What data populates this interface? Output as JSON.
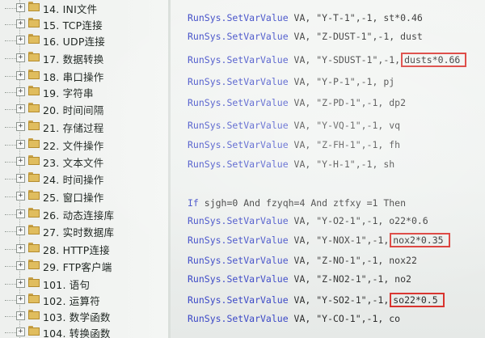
{
  "tree": {
    "items": [
      {
        "label": "14. INI文件"
      },
      {
        "label": "15. TCP连接"
      },
      {
        "label": "16. UDP连接"
      },
      {
        "label": "17. 数据转换"
      },
      {
        "label": "18. 串口操作"
      },
      {
        "label": "19. 字符串"
      },
      {
        "label": "20. 时间间隔"
      },
      {
        "label": "21. 存储过程"
      },
      {
        "label": "22. 文件操作"
      },
      {
        "label": "23. 文本文件"
      },
      {
        "label": "24. 时间操作"
      },
      {
        "label": "25. 窗口操作"
      },
      {
        "label": "26. 动态连接库"
      },
      {
        "label": "27. 实时数据库"
      },
      {
        "label": "28. HTTP连接"
      },
      {
        "label": "29. FTP客户端"
      },
      {
        "label": "101. 语句"
      },
      {
        "label": "102. 运算符"
      },
      {
        "label": "103. 数学函数"
      },
      {
        "label": "104. 转换函数"
      }
    ],
    "expander_symbol": "+"
  },
  "code": {
    "lines": [
      {
        "kw": "RunSys.SetVarValue",
        "rest": " VA, \"Y-T-1\",-1, st*0.46",
        "hl": ""
      },
      {
        "kw": "RunSys.SetVarValue",
        "rest": " VA, \"Z-DUST-1\",-1, dust",
        "hl": ""
      },
      {
        "kw": "RunSys.SetVarValue",
        "rest": " VA, \"Y-SDUST-1\",-1,",
        "hl": "dusts*0.66"
      },
      {
        "kw": "RunSys.SetVarValue",
        "rest": " VA, \"Y-P-1\",-1, pj",
        "hl": ""
      },
      {
        "kw": "RunSys.SetVarValue",
        "rest": " VA, \"Z-PD-1\",-1, dp2",
        "hl": ""
      },
      {
        "kw": "RunSys.SetVarValue",
        "rest": " VA, \"Y-VQ-1\",-1, vq",
        "hl": ""
      },
      {
        "kw": "RunSys.SetVarValue",
        "rest": " VA, \"Z-FH-1\",-1, fh",
        "hl": ""
      },
      {
        "kw": "RunSys.SetVarValue",
        "rest": " VA, \"Y-H-1\",-1, sh",
        "hl": ""
      },
      {
        "kw": "",
        "rest": "",
        "hl": ""
      },
      {
        "kw": "If",
        "rest": " sjgh=0 And fzyqh=4 And ztfxy =1 Then",
        "hl": ""
      },
      {
        "kw": "RunSys.SetVarValue",
        "rest": " VA, \"Y-O2-1\",-1, o22*0.6",
        "hl": ""
      },
      {
        "kw": "RunSys.SetVarValue",
        "rest": " VA, \"Y-NOX-1\",-1,",
        "hl": "nox2*0.35"
      },
      {
        "kw": "RunSys.SetVarValue",
        "rest": " VA, \"Z-NO-1\",-1, nox22",
        "hl": ""
      },
      {
        "kw": "RunSys.SetVarValue",
        "rest": " VA, \"Z-NO2-1\",-1, no2",
        "hl": ""
      },
      {
        "kw": "RunSys.SetVarValue",
        "rest": " VA, \"Y-SO2-1\",-1,",
        "hl": "so22*0.5"
      },
      {
        "kw": "RunSys.SetVarValue",
        "rest": " VA, \"Y-CO-1\",-1, co",
        "hl": ""
      }
    ]
  },
  "colors": {
    "highlight_box": "#d9332e",
    "keyword": "#3a47c6"
  }
}
